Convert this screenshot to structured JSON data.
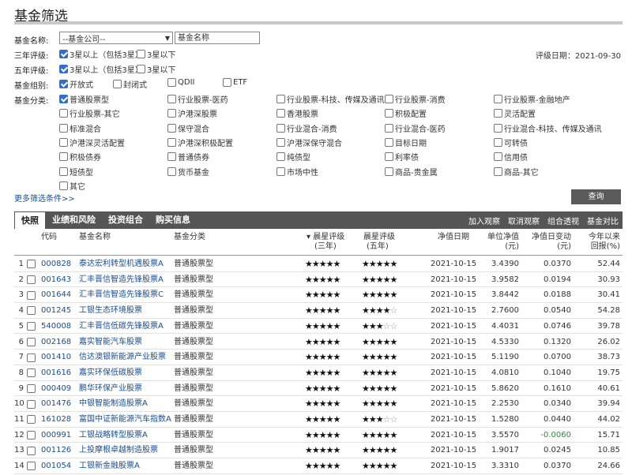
{
  "page": {
    "title": "基金筛选"
  },
  "filters": {
    "name_label": "基金名称:",
    "company_select": "--基金公司--",
    "name_input": "基金名称",
    "rating3_label": "三年评级:",
    "rating3_opts": [
      {
        "label": "3星以上（包括3星）",
        "checked": true
      },
      {
        "label": "3星以下",
        "checked": false
      }
    ],
    "rating5_label": "五年评级:",
    "rating5_opts": [
      {
        "label": "3星以上（包括3星）",
        "checked": true
      },
      {
        "label": "3星以下",
        "checked": false
      }
    ],
    "rating_date": "评级日期：2021-09-30",
    "group_label": "基金组别:",
    "group_opts": [
      {
        "label": "开放式",
        "checked": true
      },
      {
        "label": "封闭式",
        "checked": false
      },
      {
        "label": "QDII",
        "checked": false
      },
      {
        "label": "ETF",
        "checked": false
      }
    ],
    "category_label": "基金分类:",
    "category_opts": [
      [
        "普通股票型",
        "行业股票-医药",
        "行业股票-科技、传媒及通讯",
        "行业股票-消费",
        "行业股票-金融地产"
      ],
      [
        "行业股票-其它",
        "沪港深股票",
        "香港股票",
        "积极配置",
        "灵活配置"
      ],
      [
        "标准混合",
        "保守混合",
        "行业混合-消费",
        "行业混合-医药",
        "行业混合-科技、传媒及通讯"
      ],
      [
        "沪港深灵活配置",
        "沪港深积极配置",
        "沪港深保守混合",
        "目标日期",
        "可转债"
      ],
      [
        "积极债券",
        "普通债券",
        "纯债型",
        "利率债",
        "信用债"
      ],
      [
        "短债型",
        "货币基金",
        "市场中性",
        "商品-贵金属",
        "商品-其它"
      ],
      [
        "其它"
      ]
    ],
    "more_link": "更多筛选条件>>",
    "query_button": "查询"
  },
  "tabs": [
    "快照",
    "业绩和风险",
    "投资组合",
    "购买信息"
  ],
  "actions": [
    "加入观察",
    "取消观察",
    "组合透视",
    "基金对比"
  ],
  "table": {
    "headers": {
      "code": "代码",
      "name": "基金名称",
      "category": "基金分类",
      "r3a": "▾ 晨星评级",
      "r3b": "(三年)",
      "r5a": "晨星评级",
      "r5b": "(五年)",
      "date": "净值日期",
      "nav_a": "单位净值",
      "nav_b": "(元)",
      "chg_a": "净值日变动",
      "chg_b": "(元)",
      "ytd_a": "今年以来",
      "ytd_b": "回报(%)"
    },
    "rows": [
      {
        "no": "1",
        "code": "000828",
        "name": "泰达宏利转型机遇股票A",
        "cat": "普通股票型",
        "r3": 5,
        "r5": 5,
        "date": "2021-10-15",
        "nav": "3.4390",
        "chg": "0.0370",
        "ytd": "52.44"
      },
      {
        "no": "2",
        "code": "001643",
        "name": "汇丰晋信智造先锋股票A",
        "cat": "普通股票型",
        "r3": 5,
        "r5": 5,
        "date": "2021-10-15",
        "nav": "3.9582",
        "chg": "0.0194",
        "ytd": "30.93"
      },
      {
        "no": "3",
        "code": "001644",
        "name": "汇丰晋信智造先锋股票C",
        "cat": "普通股票型",
        "r3": 5,
        "r5": 5,
        "date": "2021-10-15",
        "nav": "3.8442",
        "chg": "0.0188",
        "ytd": "30.41"
      },
      {
        "no": "4",
        "code": "001245",
        "name": "工银生态环境股票",
        "cat": "普通股票型",
        "r3": 5,
        "r5": 4,
        "date": "2021-10-15",
        "nav": "2.7600",
        "chg": "0.0540",
        "ytd": "54.28"
      },
      {
        "no": "5",
        "code": "540008",
        "name": "汇丰晋信低碳先锋股票A",
        "cat": "普通股票型",
        "r3": 5,
        "r5": 3,
        "date": "2021-10-15",
        "nav": "4.4031",
        "chg": "0.0746",
        "ytd": "39.78"
      },
      {
        "no": "6",
        "code": "002168",
        "name": "嘉实智能汽车股票",
        "cat": "普通股票型",
        "r3": 5,
        "r5": 5,
        "date": "2021-10-15",
        "nav": "4.5330",
        "chg": "0.1320",
        "ytd": "26.02"
      },
      {
        "no": "7",
        "code": "001410",
        "name": "信达澳银新能源产业股票",
        "cat": "普通股票型",
        "r3": 5,
        "r5": 5,
        "date": "2021-10-15",
        "nav": "5.1190",
        "chg": "0.0700",
        "ytd": "38.73"
      },
      {
        "no": "8",
        "code": "001616",
        "name": "嘉实环保低碳股票",
        "cat": "普通股票型",
        "r3": 5,
        "r5": 5,
        "date": "2021-10-15",
        "nav": "4.0810",
        "chg": "0.1040",
        "ytd": "19.75"
      },
      {
        "no": "9",
        "code": "000409",
        "name": "鹏华环保产业股票",
        "cat": "普通股票型",
        "r3": 5,
        "r5": 5,
        "date": "2021-10-15",
        "nav": "5.8620",
        "chg": "0.1610",
        "ytd": "40.61"
      },
      {
        "no": "10",
        "code": "001476",
        "name": "中银智能制造股票A",
        "cat": "普通股票型",
        "r3": 5,
        "r5": 5,
        "date": "2021-10-15",
        "nav": "2.2530",
        "chg": "0.0340",
        "ytd": "39.94"
      },
      {
        "no": "11",
        "code": "161028",
        "name": "富国中证新能源汽车指数A",
        "cat": "普通股票型",
        "r3": 5,
        "r5": 3,
        "date": "2021-10-15",
        "nav": "1.5280",
        "chg": "0.0440",
        "ytd": "44.02"
      },
      {
        "no": "12",
        "code": "000991",
        "name": "工银战略转型股票A",
        "cat": "普通股票型",
        "r3": 5,
        "r5": 5,
        "date": "2021-10-15",
        "nav": "3.5570",
        "chg": "-0.0060",
        "ytd": "15.71"
      },
      {
        "no": "13",
        "code": "001126",
        "name": "上投摩根卓越制造股票",
        "cat": "普通股票型",
        "r3": 5,
        "r5": 5,
        "date": "2021-10-15",
        "nav": "1.9017",
        "chg": "0.0245",
        "ytd": "10.85"
      },
      {
        "no": "14",
        "code": "001054",
        "name": "工银新金融股票A",
        "cat": "普通股票型",
        "r3": 5,
        "r5": 5,
        "date": "2021-10-15",
        "nav": "3.3310",
        "chg": "0.0370",
        "ytd": "24.66"
      }
    ]
  },
  "colors": {
    "link": "#1a4d8f",
    "tabbar": "#555555",
    "negative": "#2e8b2e",
    "checkbox": "#2f6fd0"
  }
}
